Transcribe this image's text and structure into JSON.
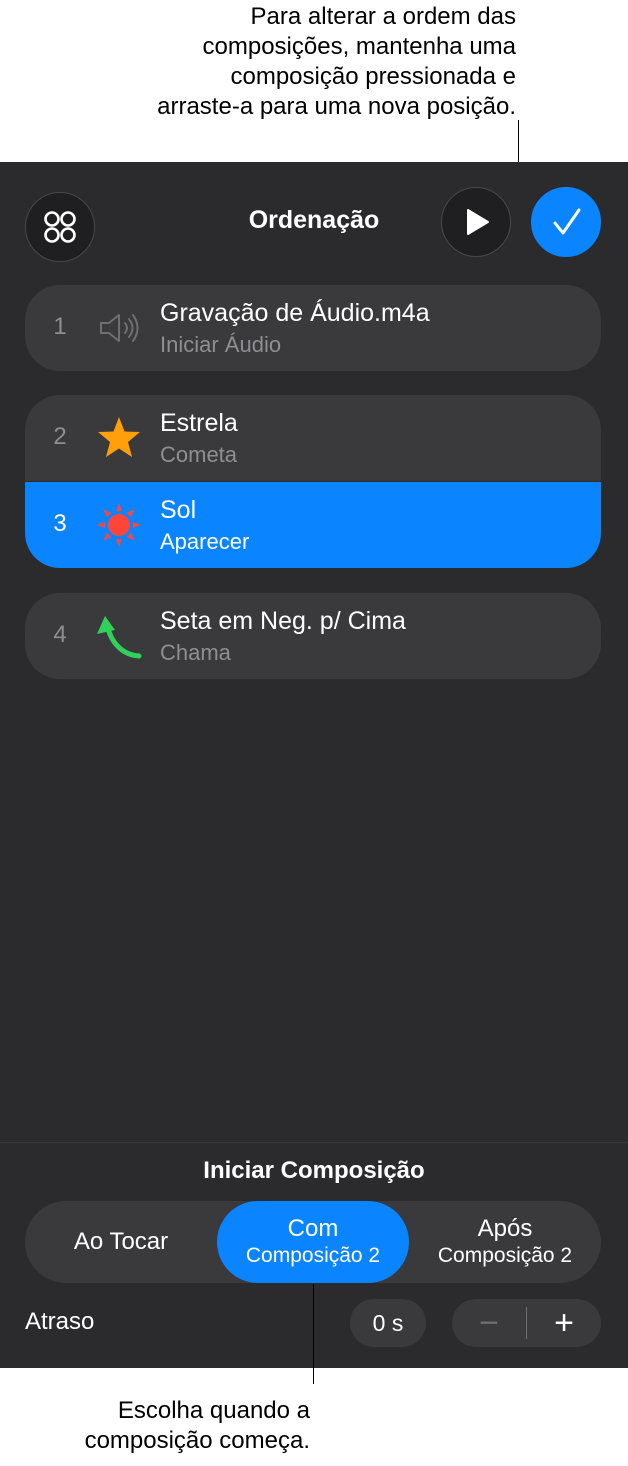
{
  "callouts": {
    "top": "Para alterar a ordem das\ncomposições, mantenha uma\ncomposição pressionada e\narraste-a para uma nova posição.",
    "bottom": "Escolha quando a\ncomposição começa."
  },
  "header": {
    "title": "Ordenação",
    "icons": {
      "left": "four-circles-icon",
      "play": "play-icon",
      "done": "checkmark-icon"
    }
  },
  "builds": [
    {
      "number": "1",
      "name": "Gravação de Áudio.m4a",
      "effect": "Iniciar Áudio",
      "icon": "speaker-icon",
      "selected": false
    },
    {
      "number": "2",
      "name": "Estrela",
      "effect": "Cometa",
      "icon": "star-icon",
      "selected": false
    },
    {
      "number": "3",
      "name": "Sol",
      "effect": "Aparecer",
      "icon": "sun-icon",
      "selected": true
    },
    {
      "number": "4",
      "name": "Seta em Neg. p/ Cima",
      "effect": "Chama",
      "icon": "curved-arrow-icon",
      "selected": false
    }
  ],
  "start_build": {
    "title": "Iniciar Composição",
    "options": [
      {
        "line1": "Ao Tocar",
        "line2": ""
      },
      {
        "line1": "Com",
        "line2": "Composição 2"
      },
      {
        "line1": "Após",
        "line2": "Composição 2"
      }
    ],
    "selected_option": "Com Composição 2",
    "delay_label": "Atraso",
    "delay_value": "0 s",
    "stepper": {
      "minus": "−",
      "plus": "+"
    }
  },
  "colors": {
    "accent": "#0a84ff",
    "panel_background": "#2b2b2d",
    "row_background": "#3a3a3c",
    "star": "#ff9f0a",
    "sun": "#ff453a",
    "arrow": "#30d158"
  }
}
